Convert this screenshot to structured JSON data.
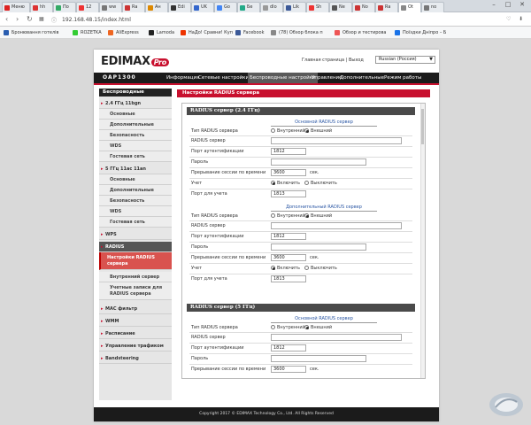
{
  "browser": {
    "tabs": [
      "Меню",
      "hh",
      "По",
      "12",
      "ww",
      "Ra",
      "Ан",
      "Edi",
      "UK",
      "Go",
      "Бе",
      "dlo",
      "Lik",
      "Sh",
      "Ne",
      "No",
      "Ra",
      "Ot",
      "no"
    ],
    "active_tab": "Ot",
    "url": "192.168.48.15/index.html",
    "bookmarks": [
      "Бронювання готелів",
      "ROZETKA",
      "AliExpress",
      "Lamoda",
      "НаДо! Сравни! Куп",
      "Facebook",
      "(78) Обзор блока п",
      "Обзор и тестирова",
      "Поїздки Дніпро – Б"
    ]
  },
  "header": {
    "logo": "EDIMAX",
    "logo_badge": "Pro",
    "home_link": "Главная страница",
    "sep": "|",
    "logout_link": "Выход",
    "language": "Russian (Россия)",
    "model": "OAP1300",
    "nav": [
      "Информация",
      "Сетевые настройки",
      "Беспроводные настройки",
      "Управление",
      "Дополнительные",
      "Режим работы"
    ],
    "nav_active": "Беспроводные настройки"
  },
  "sidebar": {
    "title": "Беспроводные",
    "items": [
      {
        "label": "2.4 ГГц 11bgn",
        "kind": "group"
      },
      {
        "label": "Основные",
        "kind": "sub"
      },
      {
        "label": "Дополнительные",
        "kind": "sub"
      },
      {
        "label": "Безопасность",
        "kind": "sub"
      },
      {
        "label": "WDS",
        "kind": "sub"
      },
      {
        "label": "Гостевая сеть",
        "kind": "sub"
      },
      {
        "label": "5 ГГц 11ac 11an",
        "kind": "group"
      },
      {
        "label": "Основные",
        "kind": "sub"
      },
      {
        "label": "Дополнительные",
        "kind": "sub"
      },
      {
        "label": "Безопасность",
        "kind": "sub"
      },
      {
        "label": "WDS",
        "kind": "sub"
      },
      {
        "label": "Гостевая сеть",
        "kind": "sub"
      },
      {
        "label": "WPS",
        "kind": "group"
      },
      {
        "label": "RADIUS",
        "kind": "section"
      },
      {
        "label": "Настройки RADIUS сервера",
        "kind": "active"
      },
      {
        "label": "Внутренний сервер",
        "kind": "sub"
      },
      {
        "label": "Учетные записи для RADIUS сервера",
        "kind": "sub"
      },
      {
        "label": "MAC фильтр",
        "kind": "group"
      },
      {
        "label": "WMM",
        "kind": "group"
      },
      {
        "label": "Расписание",
        "kind": "group"
      },
      {
        "label": "Управление трафиком",
        "kind": "group"
      },
      {
        "label": "Bandsteering",
        "kind": "group"
      }
    ]
  },
  "content": {
    "title": "Настройки RADIUS сервера",
    "sections": [
      {
        "heading": "RADIUS сервер (2.4 ГГц)",
        "primary": {
          "subtitle": "Основной RADIUS сервер",
          "type_label": "Тип RADIUS сервера",
          "internal": "Внутренний",
          "external": "Внешний",
          "selected": "external",
          "server_label": "RADIUS сервер",
          "server_value": "",
          "auth_port_label": "Порт аутентификации",
          "auth_port": "1812",
          "password_label": "Пароль",
          "password_value": "",
          "timeout_label": "Прерывание сессии по времени",
          "timeout": "3600",
          "timeout_unit": "сек.",
          "acct_label": "Учет",
          "acct_on": "Включить",
          "acct_off": "Выключить",
          "acct_selected": "on",
          "acct_port_label": "Порт для учета",
          "acct_port": "1813"
        },
        "secondary": {
          "subtitle": "Дополнительный RADIUS сервер",
          "type_label": "Тип RADIUS сервера",
          "internal": "Внутренний",
          "external": "Внешний",
          "selected": "external",
          "server_label": "RADIUS сервер",
          "server_value": "",
          "auth_port_label": "Порт аутентификации",
          "auth_port": "1812",
          "password_label": "Пароль",
          "password_value": "",
          "timeout_label": "Прерывание сессии по времени",
          "timeout": "3600",
          "timeout_unit": "сек.",
          "acct_label": "Учет",
          "acct_on": "Включить",
          "acct_off": "Выключить",
          "acct_selected": "on",
          "acct_port_label": "Порт для учета",
          "acct_port": "1813"
        }
      },
      {
        "heading": "RADIUS сервер (5 ГГц)",
        "primary": {
          "subtitle": "Основной RADIUS сервер",
          "type_label": "Тип RADIUS сервера",
          "internal": "Внутренний",
          "external": "Внешний",
          "selected": "external",
          "server_label": "RADIUS сервер",
          "server_value": "",
          "auth_port_label": "Порт аутентификации",
          "auth_port": "1812",
          "password_label": "Пароль",
          "password_value": "",
          "timeout_label": "Прерывание сессии по времени",
          "timeout": "3600",
          "timeout_unit": "сек."
        }
      }
    ]
  },
  "footer": {
    "copyright": "Copyright 2017 © EDIMAX Technology Co., Ltd. All Rights Reserved"
  },
  "colors": {
    "accent": "#c8102e",
    "nav_bg": "#1b1b1b",
    "section_bg": "#4a4a4a",
    "sub_title": "#2b57a4"
  }
}
